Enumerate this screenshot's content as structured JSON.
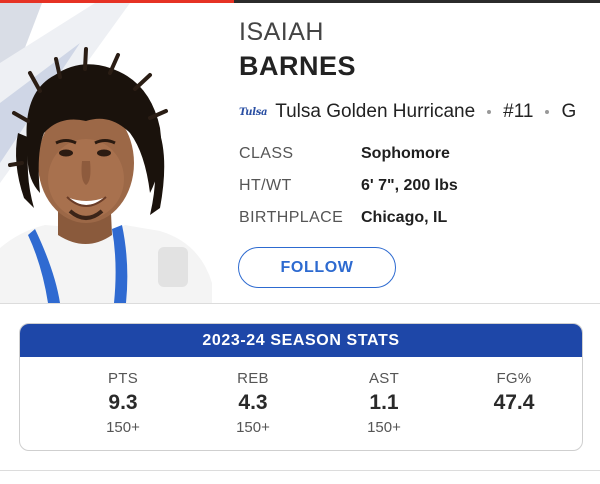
{
  "player": {
    "first_name": "ISAIAH",
    "last_name": "BARNES",
    "team_logo_text": "Tulsa",
    "team": "Tulsa Golden Hurricane",
    "number": "#11",
    "position": "G",
    "photo_icon": "player-headshot"
  },
  "info": [
    {
      "label": "CLASS",
      "value": "Sophomore"
    },
    {
      "label": "HT/WT",
      "value": "6' 7\", 200 lbs"
    },
    {
      "label": "BIRTHPLACE",
      "value": "Chicago, IL"
    }
  ],
  "follow_label": "FOLLOW",
  "stats": {
    "title": "2023-24 SEASON STATS",
    "columns": [
      {
        "label": "PTS",
        "value": "9.3",
        "rank": "150+"
      },
      {
        "label": "REB",
        "value": "4.3",
        "rank": "150+"
      },
      {
        "label": "AST",
        "value": "1.1",
        "rank": "150+"
      },
      {
        "label": "FG%",
        "value": "47.4",
        "rank": ""
      }
    ]
  },
  "colors": {
    "accent_red": "#e63224",
    "primary_blue": "#1e47a8",
    "button_blue": "#2d6ad0",
    "team_logo_blue": "#2a4fa3"
  }
}
